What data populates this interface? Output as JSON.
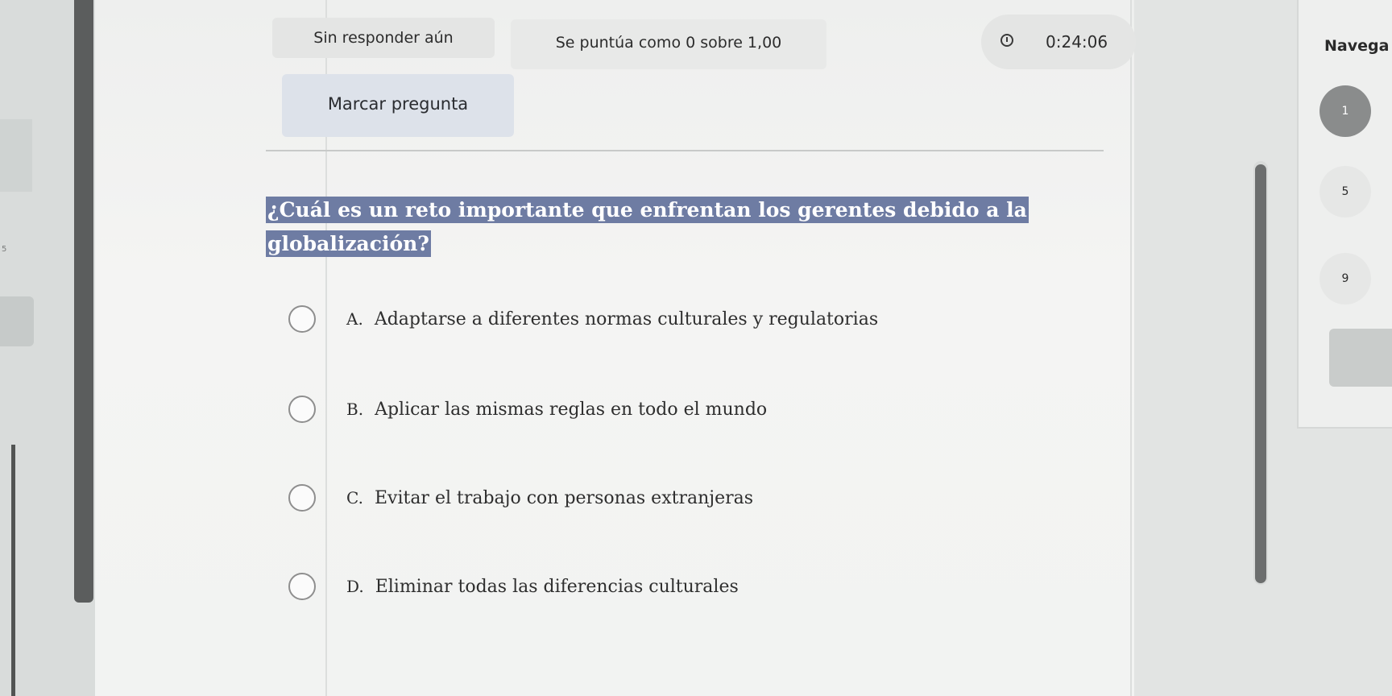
{
  "header": {
    "status": "Sin responder aún",
    "score": "Se puntúa como 0 sobre 1,00",
    "timer": "0:24:06",
    "flag_label": "Marcar pregunta"
  },
  "question": {
    "text": "¿Cuál es un reto importante que enfrentan los gerentes debido a la globalización?",
    "options": [
      {
        "letter": "A.",
        "text": "Adaptarse a diferentes normas culturales y regulatorias"
      },
      {
        "letter": "B.",
        "text": "Aplicar las mismas reglas en todo el mundo"
      },
      {
        "letter": "C.",
        "text": "Evitar el trabajo con personas extranjeras"
      },
      {
        "letter": "D.",
        "text": "Eliminar todas las diferencias culturales"
      }
    ]
  },
  "navigation": {
    "title": "Navega",
    "items": [
      "1",
      "5",
      "9"
    ]
  },
  "left_panel": {
    "digit": "5"
  }
}
